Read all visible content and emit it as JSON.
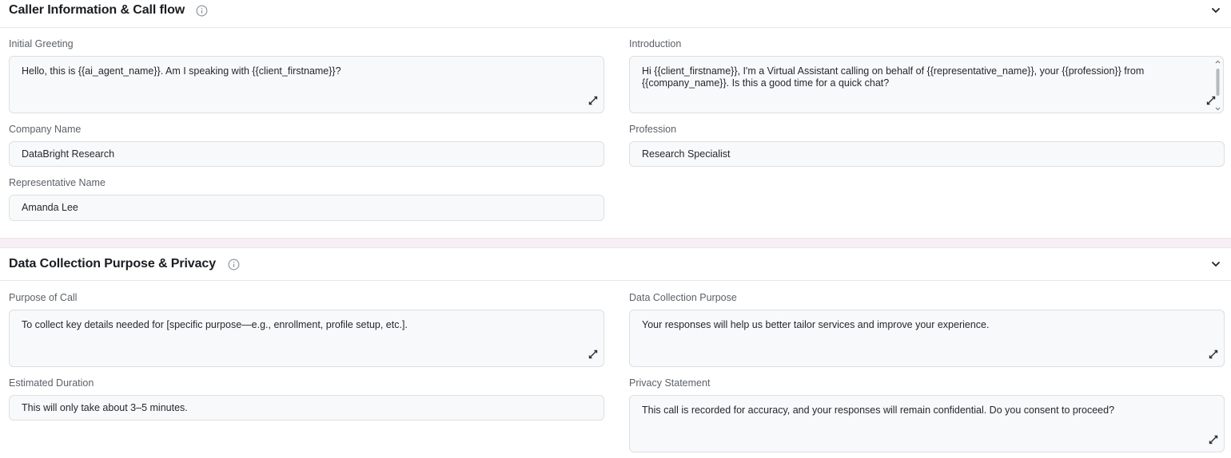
{
  "sections": [
    {
      "title": "Caller Information & Call flow",
      "fields": {
        "initial_greeting": {
          "label": "Initial Greeting",
          "value": "Hello, this is {{ai_agent_name}}. Am I speaking with {{client_firstname}}?"
        },
        "introduction": {
          "label": "Introduction",
          "value": "Hi {{client_firstname}}, I'm a Virtual Assistant calling on behalf of {{representative_name}}, your {{profession}} from {{company_name}}. Is this a good time for a quick chat?"
        },
        "company_name": {
          "label": "Company Name",
          "value": "DataBright Research"
        },
        "profession": {
          "label": "Profession",
          "value": "Research Specialist"
        },
        "representative_name": {
          "label": "Representative Name",
          "value": "Amanda Lee"
        }
      }
    },
    {
      "title": "Data Collection Purpose & Privacy",
      "fields": {
        "purpose_of_call": {
          "label": "Purpose of Call",
          "value": "To collect key details needed for [specific purpose—e.g., enrollment, profile setup, etc.]."
        },
        "data_collection_purpose": {
          "label": "Data Collection Purpose",
          "value": "Your responses will help us better tailor services and improve your experience."
        },
        "estimated_duration": {
          "label": "Estimated Duration",
          "value": "This will only take about 3–5 minutes."
        },
        "privacy_statement": {
          "label": "Privacy Statement",
          "value": "This call is recorded for accuracy, and your responses will remain confidential. Do you consent to proceed?"
        }
      }
    }
  ],
  "icons": {
    "info": "info-circle-icon",
    "collapse": "chevron-down-icon",
    "expand": "expand-arrows-icon"
  },
  "colors": {
    "divider_band": "#f6eff5",
    "field_bg": "#f8f9fa",
    "field_border": "#dcdfe3",
    "label": "#5c6168"
  }
}
